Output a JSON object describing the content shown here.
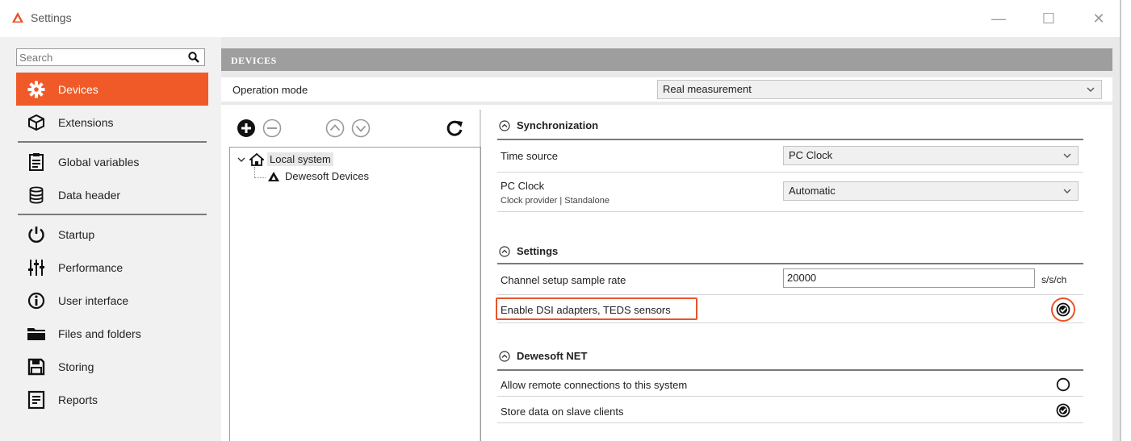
{
  "window": {
    "title": "Settings",
    "minimize_label": "—",
    "maximize_label": "☐",
    "close_label": "✕"
  },
  "sidebar": {
    "search_placeholder": "Search",
    "items": [
      {
        "label": "Devices",
        "icon": "gear-icon",
        "active": true
      },
      {
        "label": "Extensions",
        "icon": "cube-icon"
      },
      {
        "label": "Global variables",
        "icon": "clipboard-icon"
      },
      {
        "label": "Data header",
        "icon": "database-icon"
      },
      {
        "label": "Startup",
        "icon": "power-icon"
      },
      {
        "label": "Performance",
        "icon": "sliders-icon"
      },
      {
        "label": "User interface",
        "icon": "info-icon"
      },
      {
        "label": "Files and folders",
        "icon": "folder-icon"
      },
      {
        "label": "Storing",
        "icon": "save-icon"
      },
      {
        "label": "Reports",
        "icon": "report-icon"
      }
    ]
  },
  "main": {
    "header": "DEVICES",
    "operation_mode": {
      "label": "Operation mode",
      "value": "Real measurement"
    },
    "tree": {
      "root": "Local system",
      "child": "Dewesoft Devices"
    },
    "sections": {
      "synchronization": {
        "title": "Synchronization",
        "time_source": {
          "label": "Time source",
          "value": "PC Clock"
        },
        "pc_clock": {
          "label": "PC Clock",
          "sublabel": "Clock provider | Standalone",
          "value": "Automatic"
        }
      },
      "settings": {
        "title": "Settings",
        "sample_rate": {
          "label": "Channel setup sample rate",
          "value": "20000",
          "unit": "s/s/ch"
        },
        "dsi": {
          "label": "Enable DSI adapters, TEDS sensors",
          "checked": true
        }
      },
      "net": {
        "title": "Dewesoft NET",
        "remote": {
          "label": "Allow remote connections to this system",
          "checked": false
        },
        "store_slave": {
          "label": "Store data on slave clients",
          "checked": true
        }
      }
    }
  },
  "colors": {
    "accent": "#ef5a28",
    "header_bg": "#9e9e9e",
    "highlight": "#e8542a"
  }
}
